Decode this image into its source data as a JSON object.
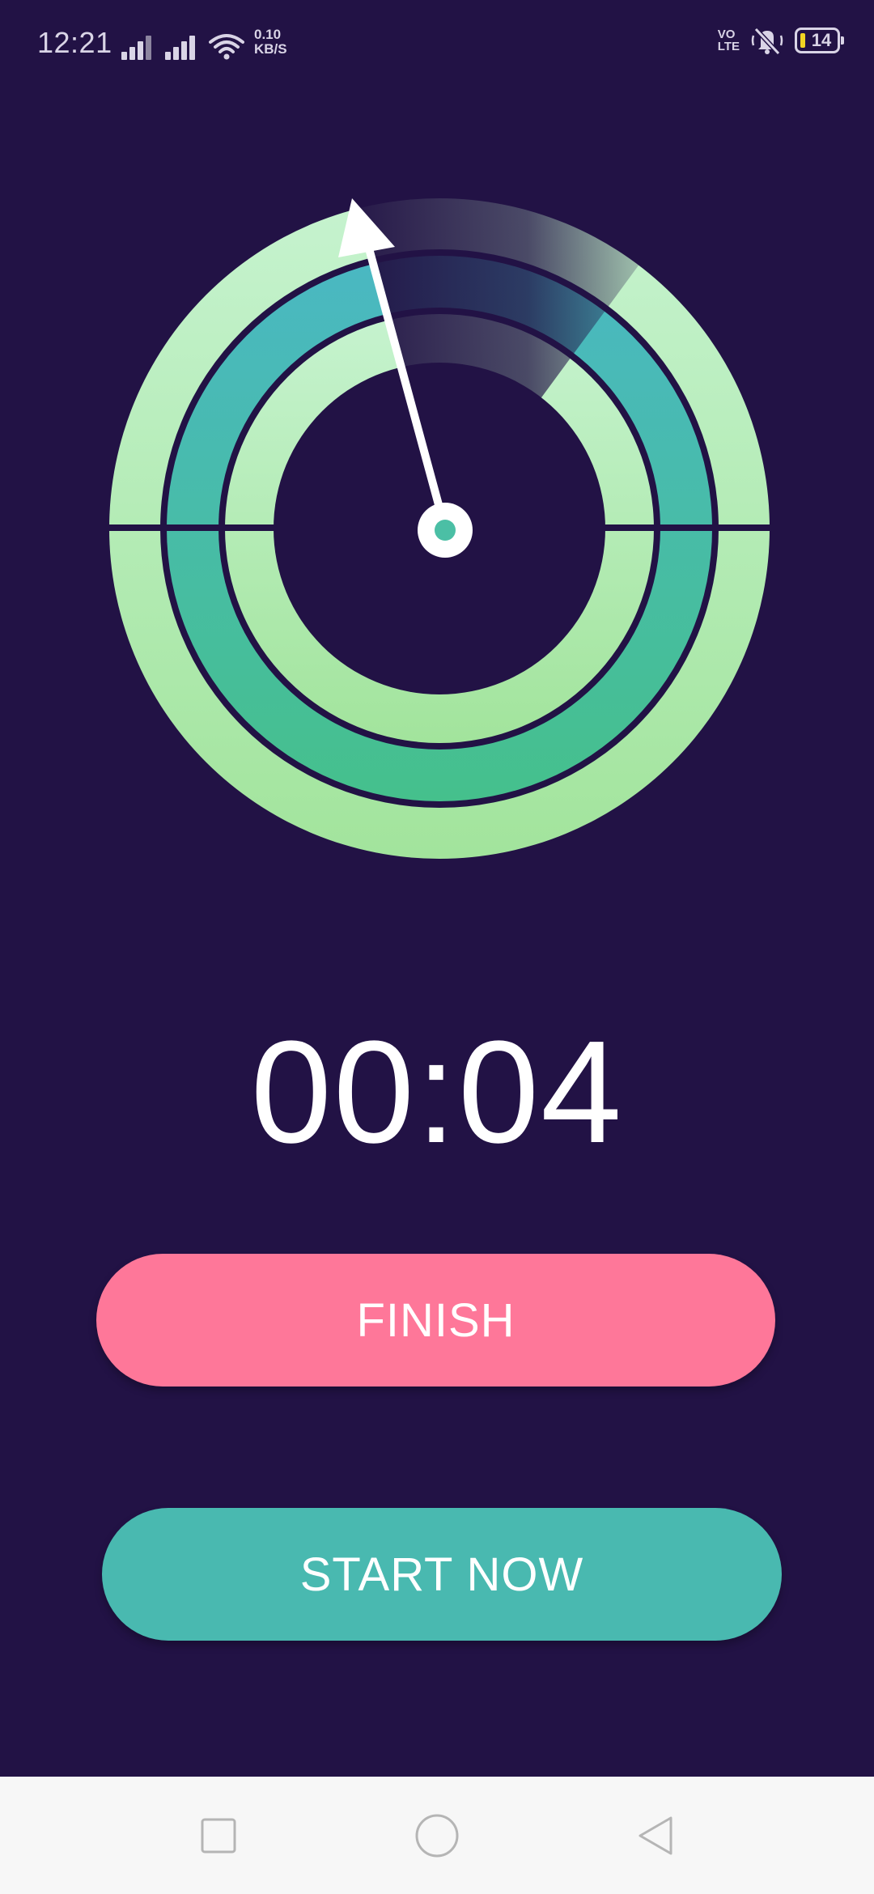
{
  "status_bar": {
    "time": "12:21",
    "net_speed_value": "0.10",
    "net_speed_unit": "KB/S",
    "volte_line1": "VO",
    "volte_line2": "LTE",
    "battery_level": "14",
    "icons": [
      "signal-icon",
      "signal-icon",
      "wifi-icon",
      "volte-icon",
      "mute-icon",
      "battery-icon"
    ]
  },
  "timer": {
    "display": "00:04"
  },
  "buttons": {
    "finish_label": "FINISH",
    "start_label": "START NOW"
  },
  "colors": {
    "background": "#221245",
    "finish": "#fe7799",
    "start": "#49b9b0",
    "ring_light": "#a8e8a6",
    "ring_teal": "#4bbfa5",
    "needle": "#ffffff"
  },
  "nav_bar": {
    "icons": [
      "recents-icon",
      "home-icon",
      "back-icon"
    ]
  }
}
